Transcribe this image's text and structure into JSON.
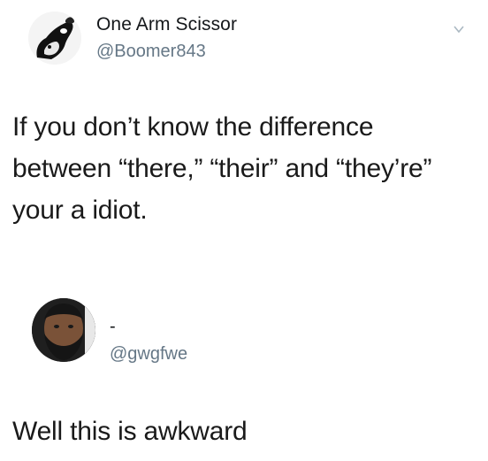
{
  "tweet_1": {
    "display_name": "One Arm Scissor",
    "handle": "@Boomer843",
    "text_lines": [
      "If you don’t know the difference",
      "between “there,” “their” and “they’re”",
      "your a idiot."
    ],
    "menu_icon": "chevron-down-icon"
  },
  "tweet_2": {
    "display_name": "-",
    "handle": "@gwgfwe",
    "text": "Well this is awkward"
  },
  "colors": {
    "text": "#14171a",
    "secondary_text": "#657786",
    "background": "#ffffff"
  }
}
